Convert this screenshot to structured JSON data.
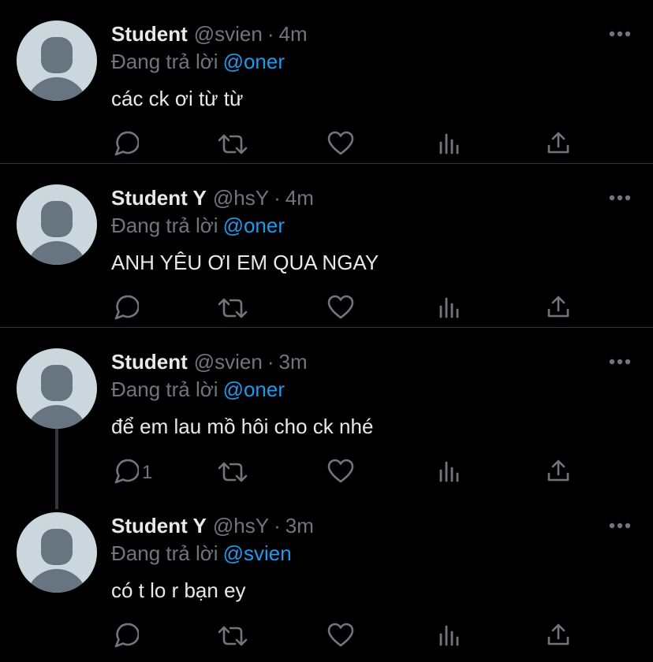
{
  "colors": {
    "background": "#000000",
    "text": "#e7e9ea",
    "muted": "#71767b",
    "accent": "#1d9bf0",
    "divider": "#2f3336",
    "avatar_bg": "#ccd6dd",
    "avatar_fg": "#66757f"
  },
  "icons": {
    "reply": "reply-icon",
    "retweet": "retweet-icon",
    "like": "like-icon",
    "views": "views-icon",
    "share": "share-icon",
    "more": "more-icon"
  },
  "tweets": [
    {
      "name": "Student",
      "handle": "@svien",
      "dot": "·",
      "time": "4m",
      "reply_prefix": "Đang trả lời",
      "reply_to": "@oner",
      "text": "các ck ơi từ từ",
      "reply_count": ""
    },
    {
      "name": "Student Y",
      "handle": "@hsY",
      "dot": "·",
      "time": "4m",
      "reply_prefix": "Đang trả lời",
      "reply_to": "@oner",
      "text": "ANH YÊU ƠI EM QUA NGAY",
      "reply_count": ""
    },
    {
      "name": "Student",
      "handle": "@svien",
      "dot": "·",
      "time": "3m",
      "reply_prefix": "Đang trả lời",
      "reply_to": "@oner",
      "text": "để em lau mồ hôi cho ck nhé",
      "reply_count": "1"
    },
    {
      "name": "Student Y",
      "handle": "@hsY",
      "dot": "·",
      "time": "3m",
      "reply_prefix": "Đang trả lời",
      "reply_to": "@svien",
      "text": "có t lo r bạn ey",
      "reply_count": ""
    }
  ]
}
